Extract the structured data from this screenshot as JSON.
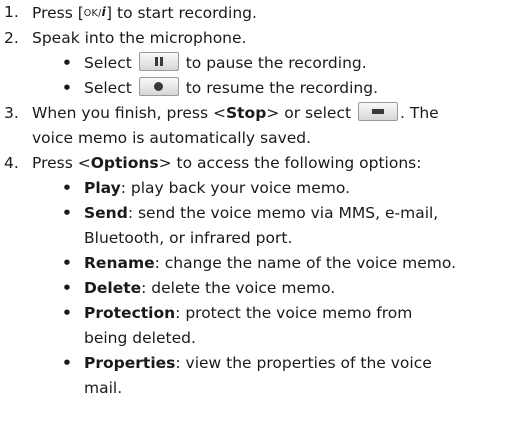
{
  "steps": [
    {
      "num": "1.",
      "pre": "Press [",
      "ok_key_main": "OK/",
      "ok_key_italic": "i",
      "post": "] to start recording."
    },
    {
      "num": "2.",
      "text": "Speak into the microphone.",
      "bullets": [
        {
          "pre": "Select",
          "icon": "pause-icon",
          "post": "to pause the recording."
        },
        {
          "pre": "Select",
          "icon": "record-icon",
          "post": "to resume the recording."
        }
      ]
    },
    {
      "num": "3.",
      "pre": "When you finish, press <",
      "bold": "Stop",
      "mid": "> or select",
      "icon": "stop-icon",
      "post": ". The",
      "line2": "voice memo is automatically saved."
    },
    {
      "num": "4.",
      "pre": "Press <",
      "bold": "Options",
      "post": "> to access the following options:",
      "options": [
        {
          "name": "Play",
          "desc": ": play back your voice memo."
        },
        {
          "name": "Send",
          "desc": ": send the voice memo via MMS, e-mail,",
          "desc2": "Bluetooth, or infrared port."
        },
        {
          "name": "Rename",
          "desc": ": change the name of the voice memo."
        },
        {
          "name": "Delete",
          "desc": ": delete the voice memo."
        },
        {
          "name": "Protection",
          "desc": ": protect the voice memo from",
          "desc2": "being deleted."
        },
        {
          "name": "Properties",
          "desc": ": view the properties of the voice",
          "desc2": "mail."
        }
      ]
    }
  ],
  "bullet_char": "•"
}
